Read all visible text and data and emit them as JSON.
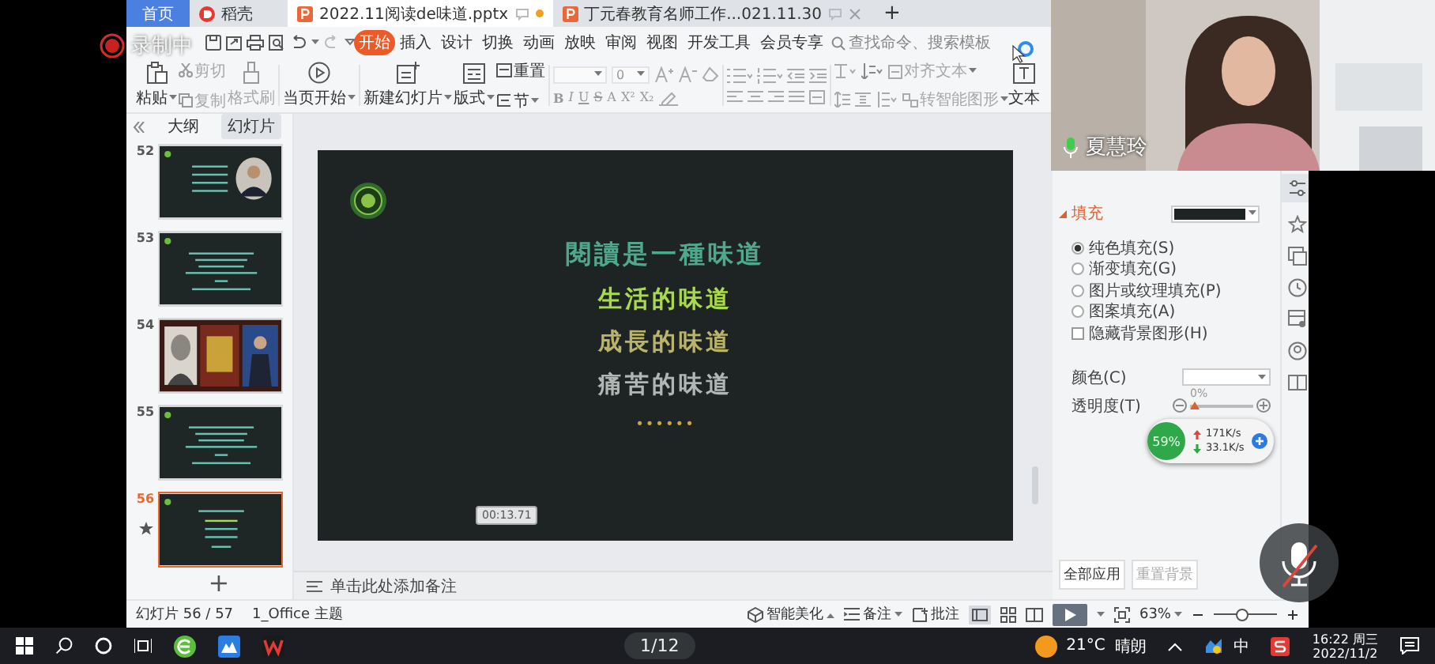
{
  "recorder": {
    "label": "录制中"
  },
  "tabs": [
    {
      "label": "首页",
      "kind": "home",
      "selected": false
    },
    {
      "label": "稻壳",
      "kind": "docer",
      "selected": false
    },
    {
      "label": "2022.11阅读de味道.pptx",
      "kind": "doc",
      "selected": true
    },
    {
      "label": "丁元春教育名师工作...021.11.30",
      "kind": "doc",
      "selected": false
    }
  ],
  "add_tab": "+",
  "menu_tabs": [
    {
      "label": "开始",
      "selected": true
    },
    {
      "label": "插入",
      "selected": false
    },
    {
      "label": "设计",
      "selected": false
    },
    {
      "label": "切换",
      "selected": false
    },
    {
      "label": "动画",
      "selected": false
    },
    {
      "label": "放映",
      "selected": false
    },
    {
      "label": "审阅",
      "selected": false
    },
    {
      "label": "视图",
      "selected": false
    },
    {
      "label": "开发工具",
      "selected": false
    },
    {
      "label": "会员专享",
      "selected": false
    }
  ],
  "search": {
    "placeholder": "查找命令、搜索模板"
  },
  "ribbon": {
    "paste": {
      "label": "粘贴",
      "disabled": false
    },
    "cut": {
      "label": "剪切",
      "disabled": true
    },
    "copy": {
      "label": "复制",
      "disabled": true
    },
    "format_painter": {
      "label": "格式刷",
      "disabled": true
    },
    "play_from_current": "当页开始",
    "new_slide": "新建幻灯片",
    "layout": "版式",
    "reset": "重置",
    "section": "节",
    "font_size": "0",
    "font_buttons": [
      "B",
      "I",
      "U",
      "S",
      "A"
    ],
    "superscript": "X²",
    "subscript": "X₂",
    "align_text": {
      "label": "对齐文本",
      "disabled": true
    },
    "smartart": {
      "label": "转智能图形",
      "disabled": true
    },
    "textbox": "文本"
  },
  "outline_tabs": [
    {
      "label": "大纲",
      "selected": false
    },
    {
      "label": "幻灯片",
      "selected": true
    }
  ],
  "slides": [
    {
      "number": "52",
      "kind": "text_photo",
      "selected": false
    },
    {
      "number": "53",
      "kind": "text",
      "selected": false
    },
    {
      "number": "54",
      "kind": "photos",
      "selected": false
    },
    {
      "number": "55",
      "kind": "text",
      "selected": false
    },
    {
      "number": "56",
      "kind": "title",
      "selected": true
    }
  ],
  "add_slide": "+",
  "slide": {
    "lines": [
      {
        "text": "閱讀是一種味道",
        "color": "#4fa88c"
      },
      {
        "text": "生活的味道",
        "color": "#a8da4c"
      },
      {
        "text": "成長的味道",
        "color": "#b9b46a"
      },
      {
        "text": "痛苦的味道",
        "color": "#b0b6b4"
      }
    ],
    "ellipsis": "••••••"
  },
  "timer": "00:13.71",
  "notes": {
    "placeholder": "单击此处添加备注"
  },
  "fill_panel": {
    "heading": "填充",
    "options": [
      {
        "label": "纯色填充(S)",
        "selected": true
      },
      {
        "label": "渐变填充(G)",
        "selected": false
      },
      {
        "label": "图片或纹理填充(P)",
        "selected": false
      },
      {
        "label": "图案填充(A)",
        "selected": false
      }
    ],
    "hide_background": {
      "label": "隐藏背景图形(H)",
      "checked": false
    },
    "color_label": "颜色(C)",
    "transparency_label": "透明度(T)",
    "transparency": {
      "reading": "0%",
      "level": 0
    },
    "buttons": [
      {
        "label": "全部应用",
        "disabled": false
      },
      {
        "label": "重置背景",
        "disabled": true
      }
    ]
  },
  "network": {
    "percent": "59%",
    "upload": "171K/s",
    "download": "33.1K/s"
  },
  "webcam": {
    "name": "夏慧玲"
  },
  "status": {
    "slide_count": "幻灯片 56 / 57",
    "theme": "1_Office 主题",
    "beautify": "智能美化",
    "notes": "备注",
    "comments": "批注",
    "zoom": "63%",
    "zoom_slider": {
      "level": 0.45
    }
  },
  "taskbar": {
    "page_indicator": "1/12",
    "temperature": "21°C",
    "weather": "晴朗",
    "ime": "中",
    "time": "16:22 周三",
    "date": "2022/11/2"
  }
}
